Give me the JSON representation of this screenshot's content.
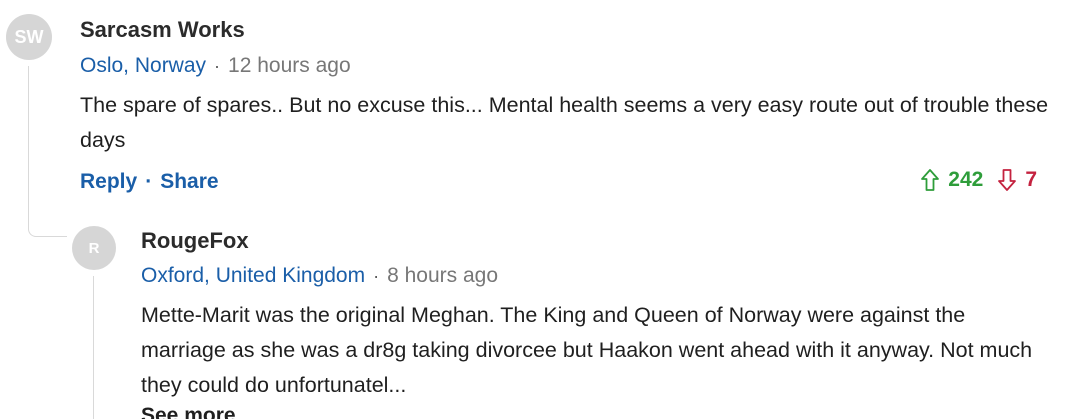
{
  "comments": [
    {
      "initials": "SW",
      "username": "Sarcasm Works",
      "location": "Oslo, Norway",
      "time": "12 hours ago",
      "text": "The spare of spares.. But no excuse this...  Mental health seems a very easy route out of trouble these days",
      "actions": {
        "reply": "Reply",
        "separator": "·",
        "share": "Share"
      },
      "votes": {
        "up": "242",
        "down": "7",
        "up_color": "#2e9d3a",
        "down_color": "#c4223f"
      }
    },
    {
      "initials": "R",
      "username": "RougeFox",
      "location": "Oxford, United Kingdom",
      "time": "8 hours ago",
      "text": "Mette-Marit was the original Meghan. The King and Queen of Norway were against the marriage as she was a dr8g taking divorcee but Haakon went ahead with it anyway. Not much they could do unfortunatel...",
      "see_more": "See more"
    }
  ],
  "meta_separator": "·",
  "colors": {
    "link": "#1a5ea8",
    "avatar_bg": "#d6d6d6"
  },
  "icons": {
    "upvote": "arrow-up-icon",
    "downvote": "arrow-down-icon"
  }
}
